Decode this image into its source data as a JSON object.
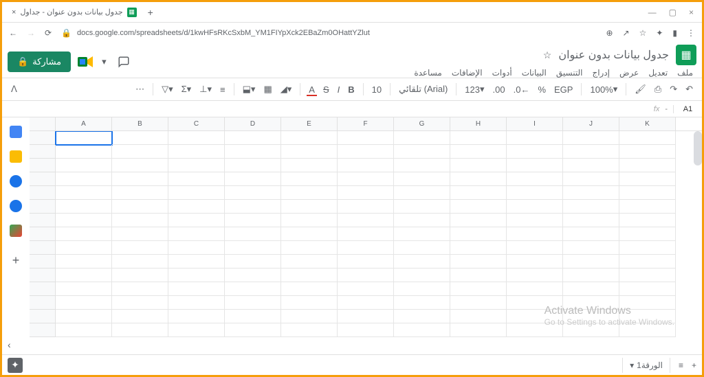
{
  "browser": {
    "tab_title": "جدول بيانات بدون عنوان - جداول",
    "url": "docs.google.com/spreadsheets/d/1kwHFsRKcSxbM_YM1FIYpXck2EBaZm0OHattYZlut"
  },
  "doc": {
    "title": "جدول بيانات بدون عنوان",
    "share_label": "مشاركة"
  },
  "menu": {
    "file": "ملف",
    "edit": "تعديل",
    "view": "عرض",
    "insert": "إدراج",
    "format": "التنسيق",
    "data": "البيانات",
    "tools": "أدوات",
    "extensions": "الإضافات",
    "help": "مساعدة"
  },
  "toolbar": {
    "zoom": "100%",
    "currency": "EGP",
    "percent": "%",
    "dec_dec": ".0←",
    "dec_inc": ".00",
    "number_format": "123",
    "font": "تلقائي (Arial)",
    "font_size": "10",
    "bold": "B",
    "italic": "I",
    "strike": "S",
    "underline_a": "A",
    "more": "⋯"
  },
  "fx": {
    "label": "fx",
    "sep": "-",
    "cell": "A1"
  },
  "columns": [
    "A",
    "B",
    "C",
    "D",
    "E",
    "F",
    "G",
    "H",
    "I",
    "J",
    "K"
  ],
  "selected_cell": "A1",
  "sheet_tab": "الورقة1",
  "watermark": {
    "line1": "Activate Windows",
    "line2": "Go to Settings to activate Windows."
  }
}
